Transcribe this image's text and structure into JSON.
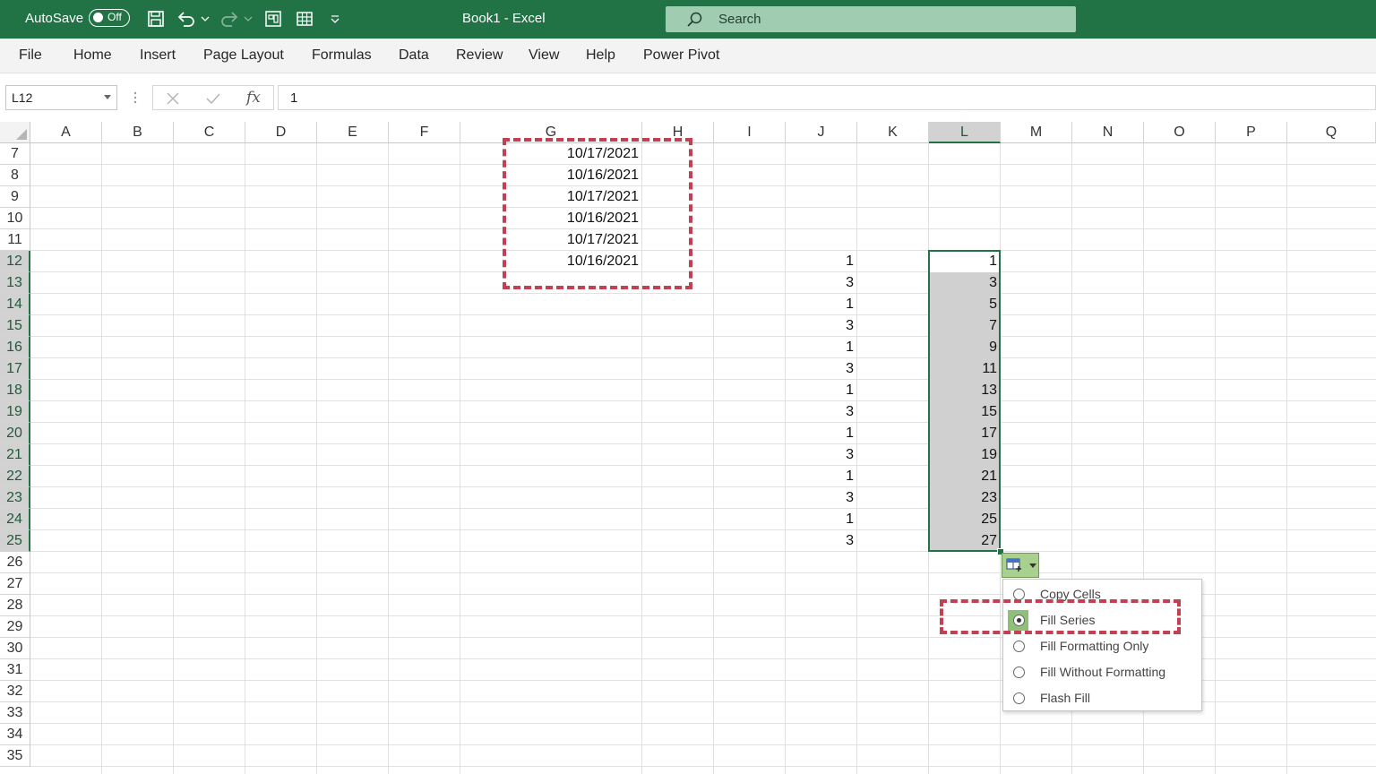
{
  "titlebar": {
    "autosave_label": "AutoSave",
    "autosave_state": "Off",
    "title": "Book1  -  Excel",
    "search_placeholder": "Search",
    "accent_color": "#217346"
  },
  "ribbon": {
    "tabs": [
      "File",
      "Home",
      "Insert",
      "Page Layout",
      "Formulas",
      "Data",
      "Review",
      "View",
      "Help",
      "Power Pivot"
    ]
  },
  "formula_bar": {
    "name_box": "L12",
    "fx_label": "fx",
    "value": "1"
  },
  "grid": {
    "columns": [
      "A",
      "B",
      "C",
      "D",
      "E",
      "F",
      "G",
      "H",
      "I",
      "J",
      "K",
      "L",
      "M",
      "N",
      "O",
      "P",
      "Q"
    ],
    "selected_column": "L",
    "rows": [
      "7",
      "8",
      "9",
      "10",
      "11",
      "12",
      "13",
      "14",
      "15",
      "16",
      "17",
      "18",
      "19",
      "20",
      "21",
      "22",
      "23",
      "24",
      "25",
      "26",
      "27",
      "28",
      "29",
      "30",
      "31",
      "32",
      "33",
      "34",
      "35"
    ],
    "selected_rows": [
      "12",
      "13",
      "14",
      "15",
      "16",
      "17",
      "18",
      "19",
      "20",
      "21",
      "22",
      "23",
      "24",
      "25"
    ],
    "g_dates": [
      "10/17/2021",
      "10/16/2021",
      "10/17/2021",
      "10/16/2021",
      "10/17/2021",
      "10/16/2021"
    ],
    "j_values": [
      "1",
      "3",
      "1",
      "3",
      "1",
      "3",
      "1",
      "3",
      "1",
      "3",
      "1",
      "3",
      "1",
      "3"
    ],
    "l_values": [
      "1",
      "3",
      "5",
      "7",
      "9",
      "11",
      "13",
      "15",
      "17",
      "19",
      "21",
      "23",
      "25",
      "27"
    ]
  },
  "autofill_options": {
    "button_icon": "autofill-options-icon",
    "items": [
      {
        "label": "Copy Cells",
        "selected": false
      },
      {
        "label": "Fill Series",
        "selected": true
      },
      {
        "label": "Fill Formatting Only",
        "selected": false
      },
      {
        "label": "Fill Without Formatting",
        "selected": false
      },
      {
        "label": "Flash Fill",
        "selected": false
      }
    ]
  }
}
